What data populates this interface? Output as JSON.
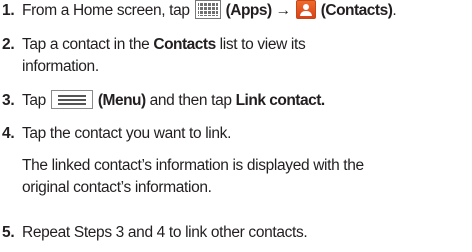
{
  "steps": [
    {
      "number": "1.",
      "parts": {
        "a": "From a Home screen, tap ",
        "b": "(Apps)",
        "c": " → ",
        "d": "(Contacts)",
        "e": "."
      },
      "icons": [
        "apps-icon",
        "contacts-icon"
      ]
    },
    {
      "number": "2.",
      "parts": {
        "a": "Tap a contact in the ",
        "b": "Contacts",
        "c": " list to view its",
        "d": "information."
      }
    },
    {
      "number": "3.",
      "parts": {
        "a": "Tap ",
        "b": "(Menu)",
        "c": " and then tap ",
        "d": "Link contact."
      },
      "icons": [
        "menu-icon"
      ]
    },
    {
      "number": "4.",
      "parts": {
        "a": "Tap the contact you want to link.",
        "b": "The linked contact’s information is displayed with the",
        "c": "original contact’s information."
      }
    },
    {
      "number": "5.",
      "parts": {
        "a": "Repeat Steps 3 and 4 to link other contacts."
      }
    }
  ]
}
